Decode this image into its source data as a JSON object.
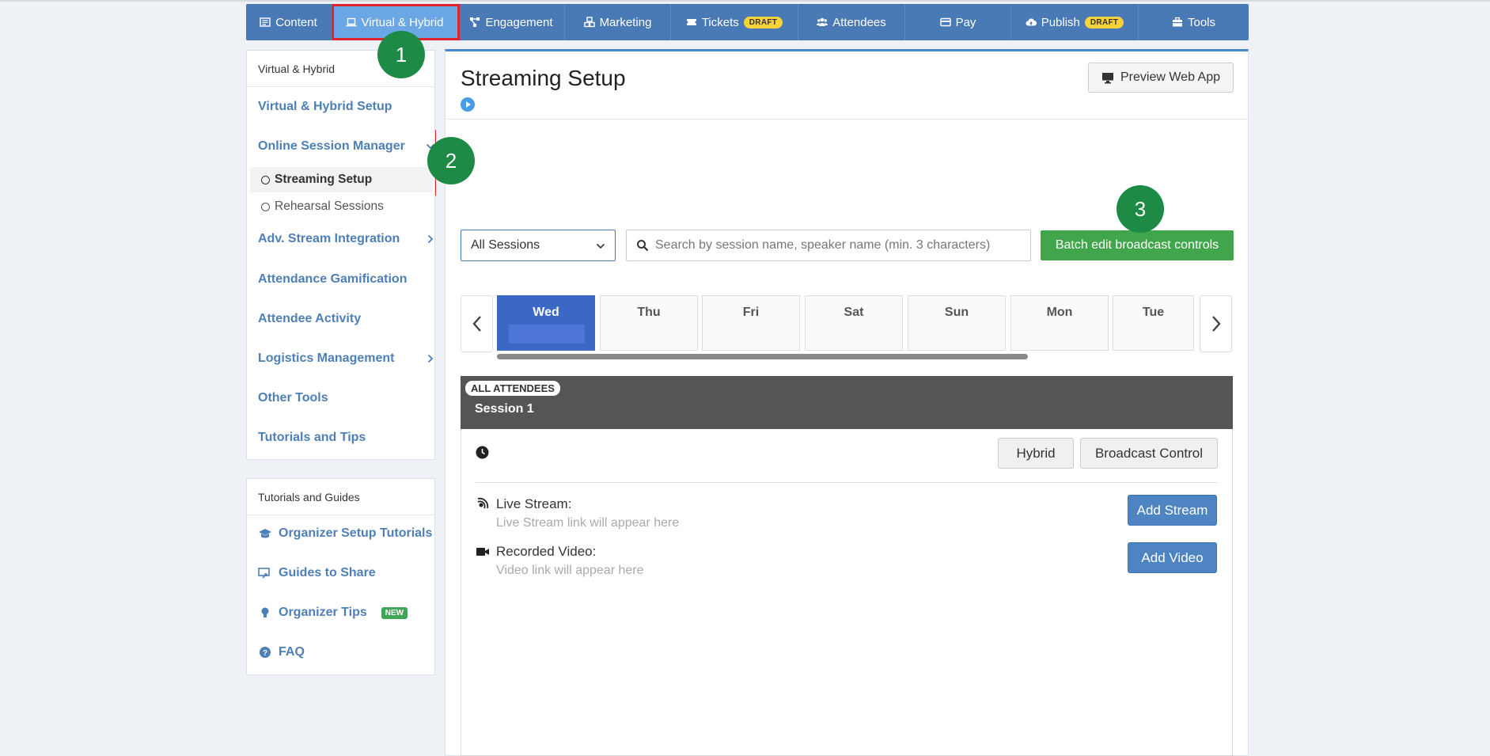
{
  "nav": {
    "items": [
      {
        "label": "Content",
        "icon": "list-icon"
      },
      {
        "label": "Virtual & Hybrid",
        "icon": "laptop-icon"
      },
      {
        "label": "Engagement",
        "icon": "network-icon"
      },
      {
        "label": "Marketing",
        "icon": "cubes-icon"
      },
      {
        "label": "Tickets",
        "icon": "ticket-icon",
        "badge": "DRAFT"
      },
      {
        "label": "Attendees",
        "icon": "users-icon"
      },
      {
        "label": "Pay",
        "icon": "credit-card-icon"
      },
      {
        "label": "Publish",
        "icon": "cloud-upload-icon",
        "badge": "DRAFT"
      },
      {
        "label": "Tools",
        "icon": "toolbox-icon"
      }
    ]
  },
  "steps": [
    "1",
    "2",
    "3"
  ],
  "sidebar": {
    "header": "Virtual & Hybrid",
    "items": [
      {
        "label": "Virtual & Hybrid Setup"
      },
      {
        "label": "Online Session Manager"
      },
      {
        "label": "Streaming Setup"
      },
      {
        "label": "Rehearsal Sessions"
      },
      {
        "label": "Adv. Stream Integration"
      },
      {
        "label": "Attendance Gamification"
      },
      {
        "label": "Attendee Activity"
      },
      {
        "label": "Logistics Management"
      },
      {
        "label": "Other Tools"
      },
      {
        "label": "Tutorials and Tips"
      }
    ]
  },
  "guides": {
    "header": "Tutorials and Guides",
    "items": [
      {
        "label": "Organizer Setup Tutorials",
        "icon": "graduation-cap-icon"
      },
      {
        "label": "Guides to Share",
        "icon": "share-screen-icon"
      },
      {
        "label": "Organizer Tips",
        "icon": "lightbulb-icon",
        "badge": "NEW"
      },
      {
        "label": "FAQ",
        "icon": "question-circle-icon"
      }
    ]
  },
  "main": {
    "title": "Streaming Setup",
    "preview_label": "Preview Web App",
    "filter_selected": "All Sessions",
    "search_placeholder": "Search by session name, speaker name (min. 3 characters)",
    "batch_label": "Batch edit broadcast controls",
    "days": [
      "Wed",
      "Thu",
      "Fri",
      "Sat",
      "Sun",
      "Mon",
      "Tue"
    ],
    "session": {
      "badge": "ALL ATTENDEES",
      "name": "Session 1",
      "hybrid_label": "Hybrid",
      "broadcast_label": "Broadcast Control",
      "live_stream_label": "Live Stream:",
      "live_stream_placeholder": "Live Stream link will appear here",
      "add_stream_label": "Add Stream",
      "recorded_label": "Recorded Video:",
      "recorded_placeholder": "Video link will appear here",
      "add_video_label": "Add Video"
    }
  },
  "colors": {
    "nav_bg": "#4a7ab6",
    "nav_active": "#6aa7e4",
    "link": "#4e7fb7",
    "highlight": "#e0242b",
    "step_badge": "#1d8a45",
    "batch_button": "#41a54b",
    "day_active": "#3a68c4",
    "draft_badge": "#f6d23b"
  }
}
